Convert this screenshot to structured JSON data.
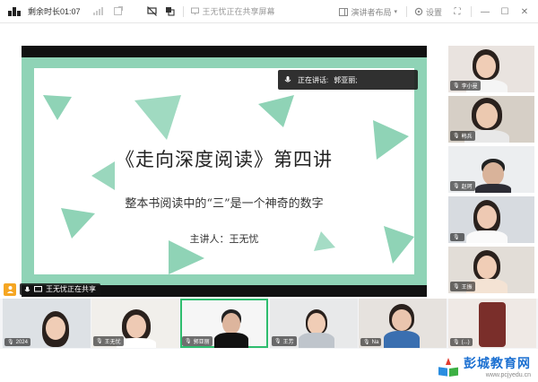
{
  "topbar": {
    "timer": "剩余时长01:07",
    "share_tip": "王无忧正在共享屏幕",
    "layout_label": "演讲者布局",
    "settings_label": "设置"
  },
  "slide": {
    "title": "《走向深度阅读》第四讲",
    "subtitle": "整本书阅读中的“三”是一个神奇的数字",
    "presenter": "主讲人：王无忧",
    "accent_color": "#8fd3b6"
  },
  "speaking": {
    "label": "正在讲话:",
    "name": "郭亚丽;"
  },
  "sharer": {
    "label": "王无忧正在共享"
  },
  "right_participants": [
    {
      "name": "李小曼",
      "icon": "mic-icon"
    },
    {
      "name": "韩兵",
      "icon": "mic-icon"
    },
    {
      "name": "赵珂",
      "icon": "mic-icon"
    },
    {
      "name": "",
      "icon": "mic-icon"
    },
    {
      "name": "王振",
      "icon": "mic-icon"
    }
  ],
  "bottom_participants": [
    {
      "name": "2024"
    },
    {
      "name": "王无忧"
    },
    {
      "name": "郭亚丽"
    },
    {
      "name": "王芳"
    },
    {
      "name": "Na"
    },
    {
      "name": "(...)"
    }
  ],
  "watermark": {
    "title": "彭城教育网",
    "url": "www.pcjyedu.cn"
  }
}
